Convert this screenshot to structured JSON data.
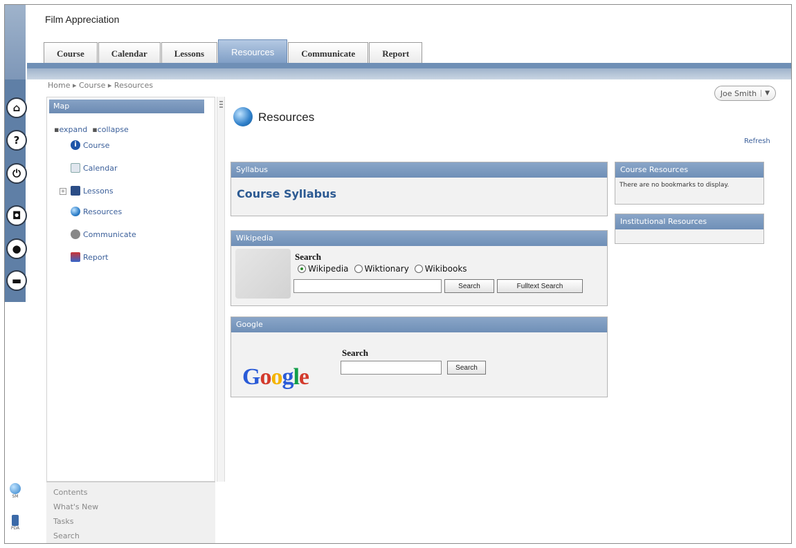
{
  "app": {
    "title": "Film Appreciation"
  },
  "tabs": [
    {
      "label": "Course"
    },
    {
      "label": "Calendar"
    },
    {
      "label": "Lessons"
    },
    {
      "label": "Resources"
    },
    {
      "label": "Communicate"
    },
    {
      "label": "Report"
    }
  ],
  "active_tab": "Resources",
  "breadcrumb": "Home ▸ Course ▸ Resources",
  "user": {
    "name": "Joe Smith"
  },
  "left_rail_icons": [
    "home-icon",
    "help-icon",
    "power-icon",
    "camera-icon",
    "user-icon",
    "chat-icon"
  ],
  "sidebar": {
    "header": "Map",
    "expand": "expand",
    "collapse": "collapse",
    "items": [
      {
        "label": "Course",
        "icon": "info-icon"
      },
      {
        "label": "Calendar",
        "icon": "calendar-icon"
      },
      {
        "label": "Lessons",
        "icon": "book-icon"
      },
      {
        "label": "Resources",
        "icon": "globe-icon"
      },
      {
        "label": "Communicate",
        "icon": "communicate-icon"
      },
      {
        "label": "Report",
        "icon": "report-icon"
      }
    ],
    "bottom_links": [
      "Contents",
      "What's New",
      "Tasks",
      "Search"
    ]
  },
  "bottom_icons": [
    {
      "icon": "sm-icon",
      "label": "SM"
    },
    {
      "icon": "pda-icon",
      "label": "PDA"
    }
  ],
  "page": {
    "title": "Resources",
    "refresh": "Refresh"
  },
  "syllabus": {
    "header": "Syllabus",
    "link": "Course Syllabus"
  },
  "wikipedia": {
    "header": "Wikipedia",
    "search_label": "Search",
    "options": [
      "Wikipedia",
      "Wiktionary",
      "Wikibooks"
    ],
    "selected": "Wikipedia",
    "search_button": "Search",
    "fulltext_button": "Fulltext Search"
  },
  "google": {
    "header": "Google",
    "logo": "Google",
    "search_label": "Search",
    "search_button": "Search"
  },
  "course_resources": {
    "header": "Course Resources",
    "empty_text": "There are no bookmarks to display."
  },
  "institutional_resources": {
    "header": "Institutional Resources"
  },
  "colors": {
    "accent": "#6f8fb7",
    "link": "#2c5a92",
    "rail": "#5f7fa6"
  }
}
